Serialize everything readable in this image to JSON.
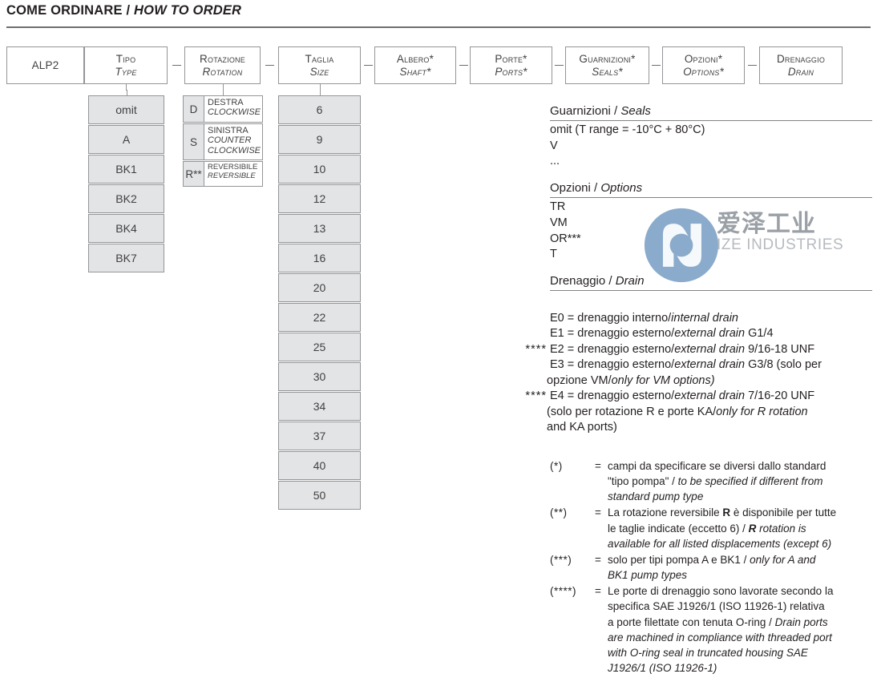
{
  "title": {
    "it": "COME ORDINARE",
    "sep": " / ",
    "en": "HOW TO ORDER"
  },
  "diagram": {
    "header_boxes": [
      {
        "l1": "ALP2",
        "l2": ""
      },
      {
        "l1": "Tipo",
        "l2": "Type"
      },
      {
        "l1": "Rotazione",
        "l2": "Rotation"
      },
      {
        "l1": "Taglia",
        "l2": "Size"
      },
      {
        "l1": "Albero*",
        "l2": "Shaft*"
      },
      {
        "l1": "Porte*",
        "l2": "Ports*"
      },
      {
        "l1": "Guarnizioni*",
        "l2": "Seals*"
      },
      {
        "l1": "Opzioni*",
        "l2": "Options*"
      },
      {
        "l1": "Drenaggio",
        "l2": "Drain"
      }
    ],
    "type_options": [
      "omit",
      "A",
      "BK1",
      "BK2",
      "BK4",
      "BK7"
    ],
    "rotation_options": [
      {
        "code": "D",
        "it": "DESTRA",
        "en": "CLOCKWISE"
      },
      {
        "code": "S",
        "it": "SINISTRA",
        "en": "COUNTER CLOCKWISE"
      },
      {
        "code": "R**",
        "it": "REVERSIBILE",
        "en": "REVERSIBLE"
      }
    ],
    "size_options": [
      "6",
      "9",
      "10",
      "12",
      "13",
      "16",
      "20",
      "22",
      "25",
      "30",
      "34",
      "37",
      "40",
      "50"
    ]
  },
  "legend": {
    "seals": {
      "head_it": "Guarnizioni",
      "head_sep": " / ",
      "head_en": "Seals",
      "lines": [
        "omit (T range = -10°C + 80°C)",
        "V",
        "..."
      ]
    },
    "options": {
      "head_it": "Opzioni",
      "head_sep": " / ",
      "head_en": "Options",
      "lines": [
        "TR",
        "VM",
        "OR***",
        "T"
      ]
    },
    "drain": {
      "head_it": "Drenaggio",
      "head_sep": " / ",
      "head_en": "Drain",
      "rows": [
        {
          "mark": "",
          "code": "E0 = ",
          "it": "drenaggio interno/",
          "en": "internal drain",
          "tail": ""
        },
        {
          "mark": "",
          "code": "E1 = ",
          "it": "drenaggio esterno/",
          "en": "external drain",
          "tail": " G1/4"
        },
        {
          "mark": "****",
          "code": "E2 = ",
          "it": "drenaggio esterno/",
          "en": "external drain",
          "tail": " 9/16-18 UNF"
        },
        {
          "mark": "",
          "code": "E3 = ",
          "it": "drenaggio esterno/",
          "en": "external drain",
          "tail": " G3/8 (solo per"
        },
        {
          "mark": "****",
          "code": "E4 = ",
          "it": "drenaggio esterno/",
          "en": "external drain",
          "tail": " 7/16-20 UNF"
        }
      ],
      "cont_e3_it": "opzione VM/",
      "cont_e3_en": "only for VM options)",
      "cont_e4_it": "(solo per rotazione R e porte KA/",
      "cont_e4_en": "only for R rotation",
      "cont_e4_en2": "and KA ports)"
    }
  },
  "notes": [
    {
      "key": "(*)",
      "eq": "=",
      "l1_it": "campi da specificare se diversi dallo standard",
      "l2_it": "\"tipo pompa\" / ",
      "l2_en": "to be specified if different from",
      "l3_en": "standard pump type"
    },
    {
      "key": "(**)",
      "eq": "=",
      "l1_a": "La rotazione reversibile ",
      "l1_b": "R",
      "l1_c": " è disponibile per tutte",
      "l2_a": "le taglie indicate (eccetto 6) / ",
      "l2_b": "R",
      "l2_c": " rotation is",
      "l3_en": "available for all listed displacements (except 6)"
    },
    {
      "key": "(***)",
      "eq": "=",
      "l1_it": "solo per tipi pompa A e BK1 / ",
      "l1_en": "only for A and",
      "l2_en": "BK1 pump types"
    },
    {
      "key": "(****)",
      "eq": "=",
      "l1_it": "Le porte di drenaggio sono lavorate secondo la",
      "l2_it": "specifica SAE J1926/1 (ISO 11926-1) relativa",
      "l3_it": "a porte filettate con tenuta O-ring / ",
      "l3_en": "Drain ports",
      "l4_en": "are machined in compliance with threaded port",
      "l5_en": "with O-ring seal in truncated housing SAE",
      "l6_en": "J1926/1 (ISO 11926-1)"
    }
  ],
  "watermark": {
    "cn": "爱泽工业",
    "en": "IZE INDUSTRIES",
    "logo_color": "#8aabcb"
  }
}
